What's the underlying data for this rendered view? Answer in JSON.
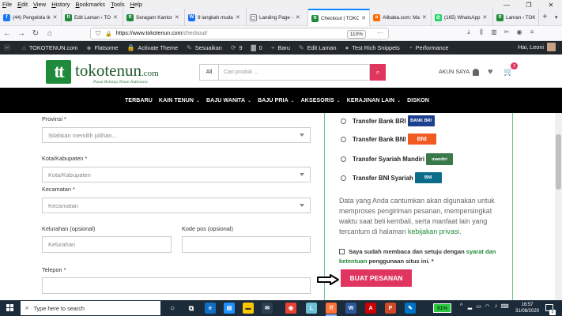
{
  "menubar": {
    "items": [
      "File",
      "Edit",
      "View",
      "History",
      "Bookmarks",
      "Tools",
      "Help"
    ]
  },
  "tabs": [
    {
      "title": "(44) Pengelola Ik",
      "color": "#1877f2",
      "glyph": "f"
    },
    {
      "title": "Edit Laman ‹ TO",
      "color": "#1f8a3a",
      "glyph": "tt"
    },
    {
      "title": "Seragam Kantor",
      "color": "#1f8a3a",
      "glyph": "tt"
    },
    {
      "title": "9 langkah muda",
      "color": "#1b6ef3",
      "glyph": "W"
    },
    {
      "title": "Landing Page -",
      "color": "#ffffff",
      "glyph": "▢"
    },
    {
      "title": "Checkout | TOKO",
      "color": "#1f8a3a",
      "glyph": "tt"
    },
    {
      "title": "Alibaba.com: Ma",
      "color": "#ff6a00",
      "glyph": "a"
    },
    {
      "title": "(165) WhatsApp",
      "color": "#25d366",
      "glyph": "✆"
    },
    {
      "title": "Laman ‹ TOKOTE",
      "color": "#1f8a3a",
      "glyph": "tt"
    }
  ],
  "nav": {
    "url_domain": "https://www.tokotenun.com",
    "url_path": "/checkout/",
    "zoom": "110%"
  },
  "wpbar": {
    "items": [
      {
        "icon": "wordpress-icon",
        "glyph": "ⓦ",
        "label": ""
      },
      {
        "icon": "home-icon",
        "glyph": "⌂",
        "label": "TOKOTENUN.com"
      },
      {
        "icon": "flatsome-icon",
        "glyph": "◈",
        "label": "Flatsome"
      },
      {
        "icon": "lock-icon",
        "glyph": "🔒",
        "label": "Activate Theme"
      },
      {
        "icon": "brush-icon",
        "glyph": "✎",
        "label": "Sesuaikan"
      },
      {
        "icon": "refresh-icon",
        "glyph": "⟳",
        "label": "9"
      },
      {
        "icon": "comment-icon",
        "glyph": "▇",
        "label": "0"
      },
      {
        "icon": "plus-icon",
        "glyph": "+",
        "label": "Baru"
      },
      {
        "icon": "pencil-icon",
        "glyph": "✎",
        "label": "Edit Laman"
      },
      {
        "icon": "circle-icon",
        "glyph": "●",
        "label": "Test Rich Snippets"
      },
      {
        "icon": "gauge-icon",
        "glyph": "◔",
        "label": "Performance"
      }
    ],
    "greeting": "Hai, Leoni"
  },
  "site": {
    "logo_mark": "tt",
    "logo_name": "tokotenun",
    "logo_tld": ".com",
    "tagline": "Pusat Belanja Tenun Indonesia",
    "search_category": "All",
    "search_placeholder": "Cari produk ...",
    "account_label": "AKUN SAYA",
    "cart_count": "3"
  },
  "mainnav": [
    {
      "label": "TERBARU",
      "chevron": false
    },
    {
      "label": "KAIN TENUN",
      "chevron": true
    },
    {
      "label": "BAJU WANITA",
      "chevron": true
    },
    {
      "label": "BAJU PRIA",
      "chevron": true
    },
    {
      "label": "AKSESORIS",
      "chevron": true
    },
    {
      "label": "KERAJINAN LAIN",
      "chevron": true
    },
    {
      "label": "DISKON",
      "chevron": false
    }
  ],
  "form": {
    "provinsi_label": "Provinsi",
    "provinsi_value": "Silahkan memilih pilihan...",
    "kota_label": "Kota/Kabupaten",
    "kota_value": "Kota/Kabupaten",
    "kecamatan_label": "Kecamatan",
    "kecamatan_value": "Kecamatan",
    "kelurahan_label": "Kelurahan (opsional)",
    "kelurahan_placeholder": "Kelurahan",
    "kodepos_label": "Kode pos (opsional)",
    "telepon_label": "Telepon",
    "required_mark": "*"
  },
  "payment": {
    "options": [
      {
        "label": "Transfer Bank BRI",
        "logo": "BANK BRI",
        "logo_color": "#1d3f8f"
      },
      {
        "label": "Transfer Bank BNI",
        "logo": "BNI",
        "logo_color": "#f15a22"
      },
      {
        "label": "Transfer Syariah Mandiri",
        "logo": "mandiri",
        "logo_color": "#3a7a4a"
      },
      {
        "label": "Transfer BNI Syariah",
        "logo": "BNI",
        "logo_color": "#0b6d8a"
      }
    ],
    "privacy_text": "Data yang Anda cantumkan akan digunakan untuk memproses pengiriman pesanan, mempersingkat waktu saat beli kembali, serta manfaat lain yang tercantum di halaman ",
    "privacy_link": "kebijakan privasi",
    "privacy_end": ".",
    "terms_prefix": "Saya sudah membaca dan setuju dengan ",
    "terms_link": "syarat dan ketentuan",
    "terms_suffix": " penggunaan situs ini.",
    "terms_req": " *",
    "submit_label": "BUAT PESANAN"
  },
  "taskbar": {
    "search_placeholder": "Type here to search",
    "battery": "91%",
    "time": "16:57",
    "date": "31/08/2020",
    "notif_count": "3"
  },
  "colors": {
    "accent": "#e0355f",
    "brand_green": "#1f8a3a"
  }
}
